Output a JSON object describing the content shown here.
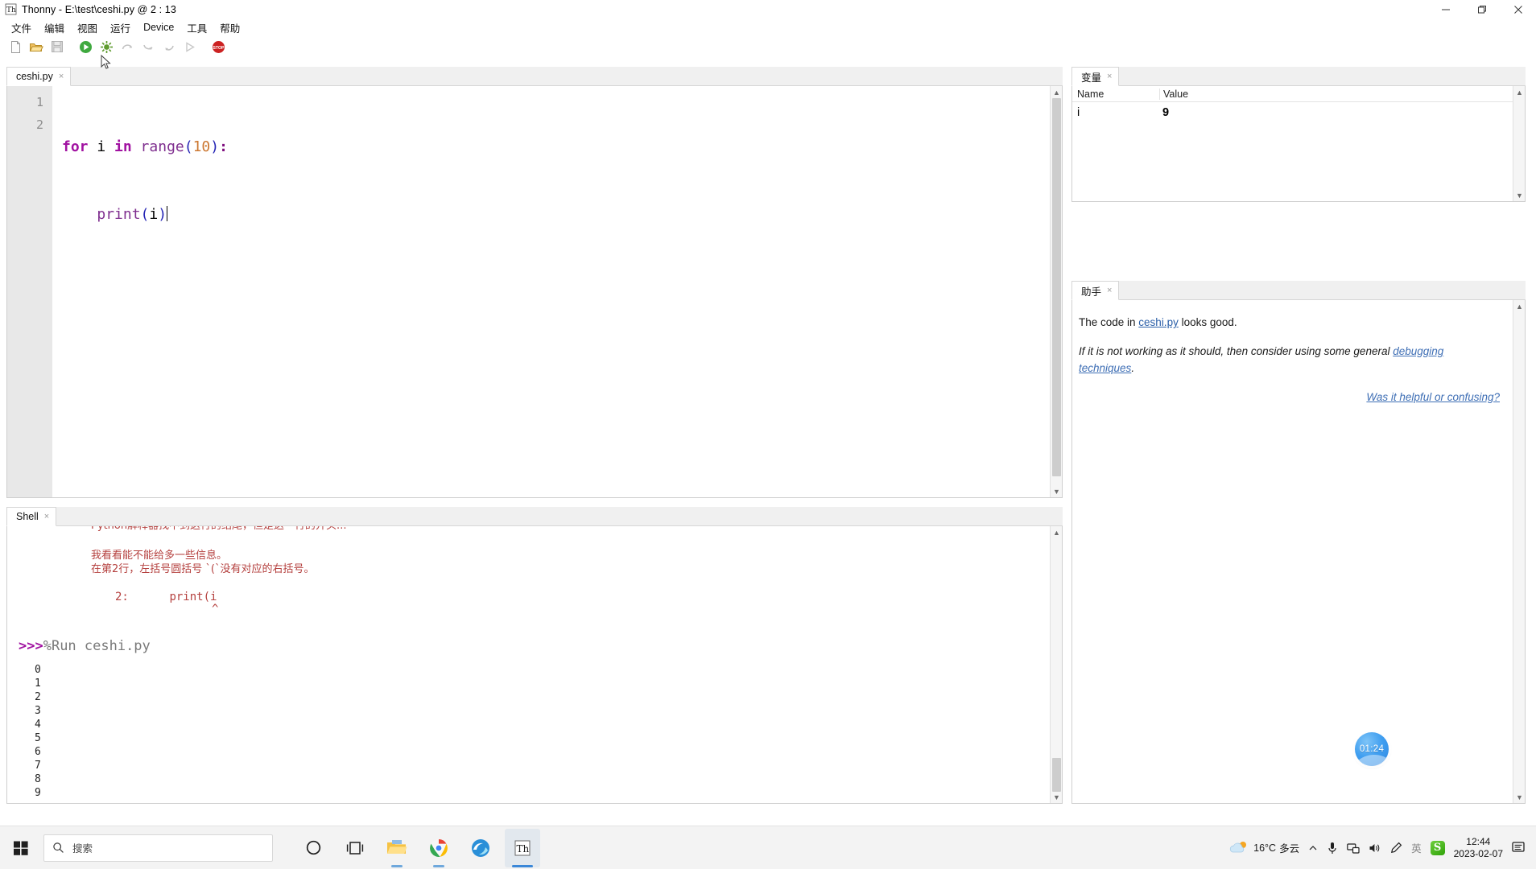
{
  "window": {
    "app_icon": "thonny-icon",
    "title": "Thonny  -  E:\\test\\ceshi.py  @  2 : 13",
    "minimize": "—",
    "maximize": "❐",
    "close": "✕"
  },
  "menu": {
    "items": [
      {
        "label": "文件",
        "name": "menu-file"
      },
      {
        "label": "编辑",
        "name": "menu-edit"
      },
      {
        "label": "视图",
        "name": "menu-view"
      },
      {
        "label": "运行",
        "name": "menu-run"
      },
      {
        "label": "Device",
        "name": "menu-device"
      },
      {
        "label": "工具",
        "name": "menu-tools"
      },
      {
        "label": "帮助",
        "name": "menu-help"
      }
    ]
  },
  "toolbar": {
    "buttons": [
      {
        "name": "new-file-icon",
        "title": "New"
      },
      {
        "name": "open-file-icon",
        "title": "Open"
      },
      {
        "name": "save-file-icon",
        "title": "Save"
      },
      {
        "name": "run-icon",
        "title": "Run"
      },
      {
        "name": "debug-icon",
        "title": "Debug"
      },
      {
        "name": "step-over-icon",
        "title": "Step over"
      },
      {
        "name": "step-into-icon",
        "title": "Step into"
      },
      {
        "name": "step-out-icon",
        "title": "Step out"
      },
      {
        "name": "resume-icon",
        "title": "Resume"
      },
      {
        "name": "stop-icon",
        "title": "Stop"
      }
    ]
  },
  "editor": {
    "tab_label": "ceshi.py",
    "tab_close": "×",
    "line_numbers": [
      "1",
      "2"
    ],
    "code": {
      "line1": {
        "kw_for": "for",
        "var_i": " i ",
        "kw_in": "in",
        "fn_range": " range",
        "paren_open": "(",
        "num_10": "10",
        "paren_close": ")",
        "colon": ":"
      },
      "line2": {
        "indent": "    ",
        "fn_print": "print",
        "paren_open": "(",
        "arg_i": "i",
        "paren_close": ")"
      }
    }
  },
  "shell": {
    "tab_label": "Shell",
    "tab_close": "×",
    "clipped_line": "Python解释器找不到这行的结尾，但是这一行的开头...",
    "err_line1": "我看看能不能给多一些信息。",
    "err_line2": "在第2行，左括号圆括号 `(`没有对应的右括号。",
    "err_code_lineno": "2:",
    "err_code_text": "print(i",
    "err_caret": "^",
    "prompt": ">>>",
    "run_command": "%Run ceshi.py",
    "output": [
      "0",
      "1",
      "2",
      "3",
      "4",
      "5",
      "6",
      "7",
      "8",
      "9"
    ],
    "prompt_end": ">>>"
  },
  "variables": {
    "tab_label": "变量",
    "tab_close": "×",
    "columns": [
      "Name",
      "Value"
    ],
    "rows": [
      {
        "name": "i",
        "value": "9"
      }
    ]
  },
  "assistant": {
    "tab_label": "助手",
    "tab_close": "×",
    "line1_prefix": "The code in ",
    "line1_link": "ceshi.py",
    "line1_suffix": " looks good.",
    "line2_prefix": "If it is not working as it should, then consider using some general ",
    "line2_link": "debugging techniques",
    "line2_suffix": ".",
    "feedback_link": "Was it helpful or confusing?"
  },
  "timer": {
    "label": "01:24"
  },
  "ime": {
    "logo": "S",
    "mode": "英",
    "items": [
      "moon-icon",
      "punctuation-icon",
      "keyboard-icon",
      "user-icon",
      "toolbox-icon"
    ]
  },
  "taskbar": {
    "start": "start-icon",
    "search_placeholder": "搜索",
    "apps": [
      {
        "name": "cortana-icon",
        "label": "O"
      },
      {
        "name": "task-view-icon",
        "label": "⊟"
      },
      {
        "name": "file-explorer-icon",
        "label": ""
      },
      {
        "name": "chrome-icon",
        "label": ""
      },
      {
        "name": "edge-icon",
        "label": ""
      },
      {
        "name": "thonny-taskbar-icon",
        "label": ""
      }
    ],
    "tray": {
      "weather_temp": "16°C",
      "weather_desc": "多云",
      "chevron": "︿",
      "mic": "mic-icon",
      "network": "network-icon",
      "volume": "volume-icon",
      "pen": "pen-icon",
      "ime_lang": "英",
      "sogou": "S",
      "time": "12:44",
      "date": "2023-02-07",
      "notification": "notification-icon"
    }
  }
}
